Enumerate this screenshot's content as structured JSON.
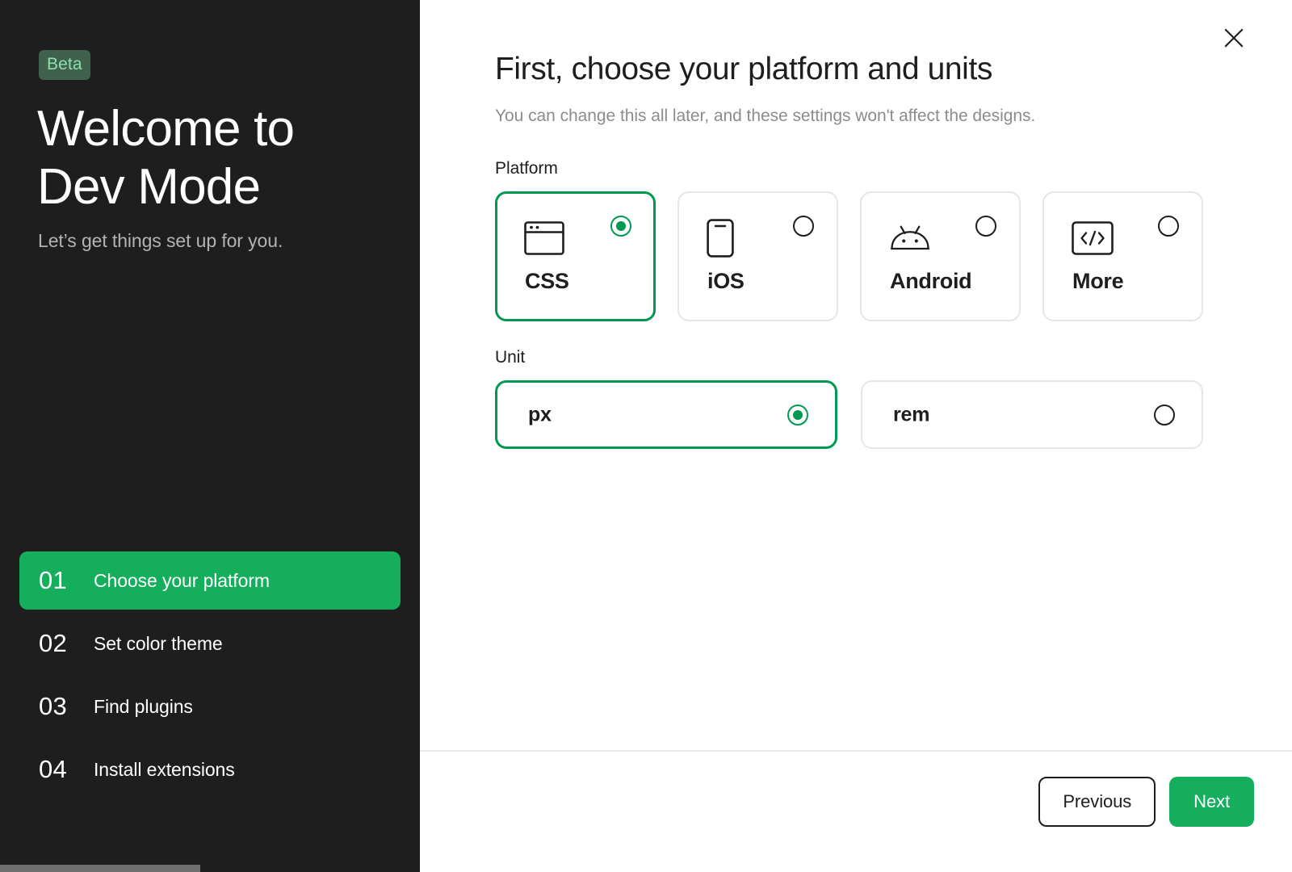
{
  "sidebar": {
    "badge": "Beta",
    "title": "Welcome to\nDev Mode",
    "subtitle": "Let’s get things set up for you.",
    "steps": [
      {
        "num": "01",
        "label": "Choose your platform",
        "active": true
      },
      {
        "num": "02",
        "label": "Set color theme",
        "active": false
      },
      {
        "num": "03",
        "label": "Find plugins",
        "active": false
      },
      {
        "num": "04",
        "label": "Install extensions",
        "active": false
      }
    ]
  },
  "main": {
    "close_icon": "close-icon",
    "title": "First, choose your platform and units",
    "subtitle": "You can change this all later, and these settings won't affect the designs.",
    "platform": {
      "label": "Platform",
      "selected": "CSS",
      "options": [
        {
          "label": "CSS",
          "icon": "browser-window-icon",
          "selected": true
        },
        {
          "label": "iOS",
          "icon": "phone-icon",
          "selected": false
        },
        {
          "label": "Android",
          "icon": "android-robot-icon",
          "selected": false
        },
        {
          "label": "More",
          "icon": "code-brackets-icon",
          "selected": false
        }
      ]
    },
    "unit": {
      "label": "Unit",
      "selected": "px",
      "options": [
        {
          "label": "px",
          "selected": true
        },
        {
          "label": "rem",
          "selected": false
        }
      ]
    }
  },
  "footer": {
    "previous_label": "Previous",
    "next_label": "Next"
  },
  "colors": {
    "accent_green": "#14AE5C",
    "selected_border_green": "#009951",
    "sidebar_bg": "#1E1E1E",
    "badge_bg": "#40614E",
    "badge_text": "#8CE0AE",
    "muted_text": "#8C8C8C",
    "card_border": "#E6E6E6"
  }
}
